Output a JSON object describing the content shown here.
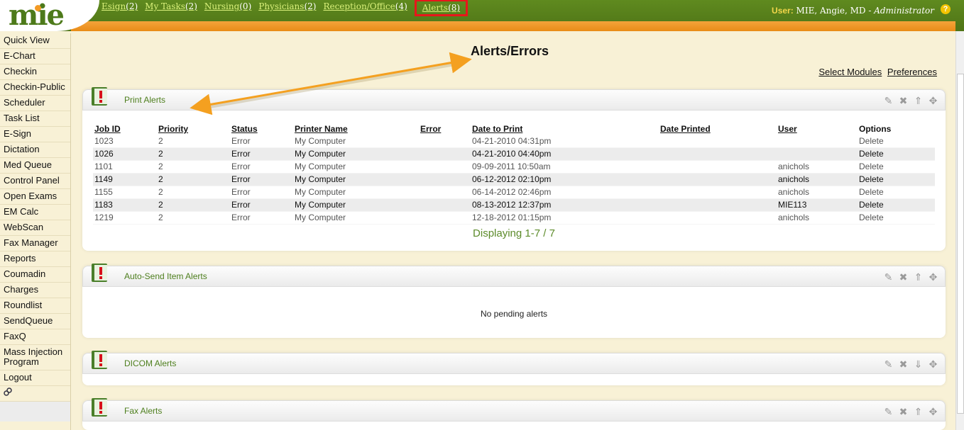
{
  "header": {
    "logo": "mie",
    "tabs": [
      {
        "label": "Esign",
        "count": "(2)"
      },
      {
        "label": "My Tasks",
        "count": "(2)"
      },
      {
        "label": "Nursing",
        "count": "(0)"
      },
      {
        "label": "Physicians",
        "count": "(2)"
      },
      {
        "label": "Reception/Office",
        "count": "(4)"
      },
      {
        "label": "Alerts",
        "count": "(8)"
      }
    ],
    "user_label": "User:",
    "user_name": "MIE, Angie, MD",
    "user_sep": " - ",
    "user_role": "Administrator",
    "help_icon": "?"
  },
  "sidebar": {
    "items": [
      "Quick View",
      "E-Chart",
      "Checkin",
      "Checkin-Public",
      "Scheduler",
      "Task List",
      "E-Sign",
      "Dictation",
      "Med Queue",
      "Control Panel",
      "Open Exams",
      "EM Calc",
      "WebScan",
      "Fax Manager",
      "Reports",
      "Coumadin",
      "Charges",
      "Roundlist",
      "SendQueue",
      "FaxQ",
      "Mass Injection Program",
      "Logout"
    ]
  },
  "main": {
    "title": "Alerts/Errors",
    "links": [
      "Select Modules",
      "Preferences"
    ]
  },
  "print_alerts": {
    "title": "Print Alerts",
    "columns": [
      "Job ID",
      "Priority",
      "Status",
      "Printer Name",
      "Error",
      "Date to Print",
      "Date Printed",
      "User",
      "Options"
    ],
    "rows": [
      [
        "1023",
        "2",
        "Error",
        "My Computer",
        "",
        "04-21-2010 04:31pm",
        "",
        "",
        "Delete"
      ],
      [
        "1026",
        "2",
        "Error",
        "My Computer",
        "",
        "04-21-2010 04:40pm",
        "",
        "",
        "Delete"
      ],
      [
        "1101",
        "2",
        "Error",
        "My Computer",
        "",
        "09-09-2011 10:50am",
        "",
        "anichols",
        "Delete"
      ],
      [
        "1149",
        "2",
        "Error",
        "My Computer",
        "",
        "06-12-2012 02:10pm",
        "",
        "anichols",
        "Delete"
      ],
      [
        "1155",
        "2",
        "Error",
        "My Computer",
        "",
        "06-14-2012 02:46pm",
        "",
        "anichols",
        "Delete"
      ],
      [
        "1183",
        "2",
        "Error",
        "My Computer",
        "",
        "08-13-2012 12:37pm",
        "",
        "MIE113",
        "Delete"
      ],
      [
        "1219",
        "2",
        "Error",
        "My Computer",
        "",
        "12-18-2012 01:15pm",
        "",
        "anichols",
        "Delete"
      ]
    ],
    "footer": "Displaying 1-7 / 7"
  },
  "auto_send": {
    "title": "Auto-Send Item Alerts",
    "empty": "No pending alerts"
  },
  "dicom": {
    "title": "DICOM Alerts"
  },
  "fax": {
    "title": "Fax Alerts"
  },
  "colors": {
    "header_green": "#5f8a1f",
    "header_orange": "#f4a33a",
    "tab_text": "#d9f07a",
    "highlight_box": "#e8161b",
    "panel_title": "#4e7f1e",
    "annotation_arrow": "#f4a020"
  },
  "icons": {
    "panel_icon": "alert-book-icon",
    "tools": [
      "edit-icon",
      "close-icon",
      "collapse-icon",
      "move-icon"
    ]
  }
}
